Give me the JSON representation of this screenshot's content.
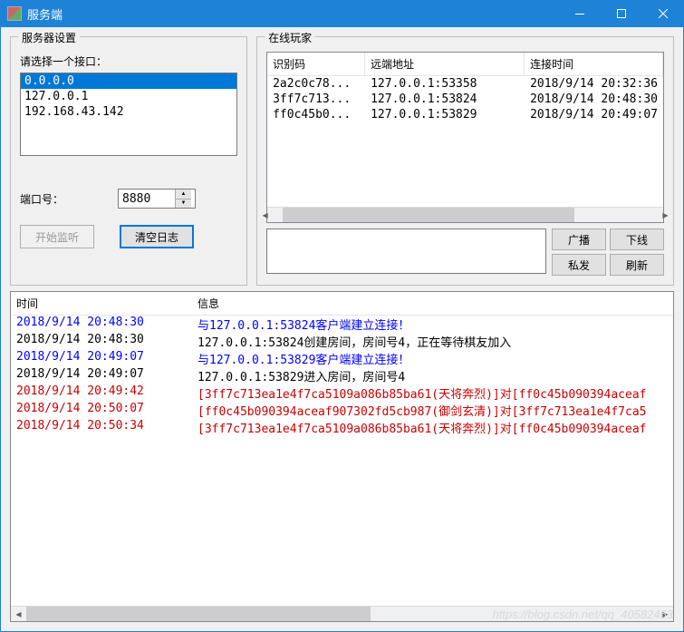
{
  "window": {
    "title": "服务端"
  },
  "server_settings": {
    "group_title": "服务器设置",
    "interface_label": "请选择一个接口：",
    "interfaces": [
      "0.0.0.0",
      "127.0.0.1",
      "192.168.43.142"
    ],
    "selected_index": 0,
    "port_label": "端口号：",
    "port_value": "8880",
    "start_listen": "开始监听",
    "clear_log": "清空日志"
  },
  "online_players": {
    "group_title": "在线玩家",
    "columns": {
      "id": "识别码",
      "addr": "远端地址",
      "time": "连接时间"
    },
    "rows": [
      {
        "id": "2a2c0c78...",
        "addr": "127.0.0.1:53358",
        "time": "2018/9/14 20:32:36"
      },
      {
        "id": "3ff7c713...",
        "addr": "127.0.0.1:53824",
        "time": "2018/9/14 20:48:30"
      },
      {
        "id": "ff0c45b0...",
        "addr": "127.0.0.1:53829",
        "time": "2018/9/14 20:49:07"
      }
    ],
    "btn_broadcast": "广播",
    "btn_kick": "下线",
    "btn_private": "私发",
    "btn_refresh": "刷新"
  },
  "log": {
    "columns": {
      "time": "时间",
      "msg": "信息"
    },
    "rows": [
      {
        "time": "2018/9/14 20:48:30",
        "msg": "与127.0.0.1:53824客户端建立连接！",
        "color": "blue"
      },
      {
        "time": "2018/9/14 20:48:30",
        "msg": "127.0.0.1:53824创建房间，房间号4，正在等待棋友加入",
        "color": "black"
      },
      {
        "time": "2018/9/14 20:49:07",
        "msg": "与127.0.0.1:53829客户端建立连接！",
        "color": "blue"
      },
      {
        "time": "2018/9/14 20:49:07",
        "msg": "127.0.0.1:53829进入房间，房间号4",
        "color": "black"
      },
      {
        "time": "2018/9/14 20:49:42",
        "msg": "[3ff7c713ea1e4f7ca5109a086b85ba61(天将奔烈)]对[ff0c45b090394aceaf",
        "color": "red"
      },
      {
        "time": "2018/9/14 20:50:07",
        "msg": "[ff0c45b090394aceaf907302fd5cb987(御剑玄清)]对[3ff7c713ea1e4f7ca5",
        "color": "red"
      },
      {
        "time": "2018/9/14 20:50:34",
        "msg": "[3ff7c713ea1e4f7ca5109a086b85ba61(天将奔烈)]对[ff0c45b090394aceaf",
        "color": "red"
      }
    ]
  },
  "watermark": "https://blog.csdn.net/qq_40582463"
}
